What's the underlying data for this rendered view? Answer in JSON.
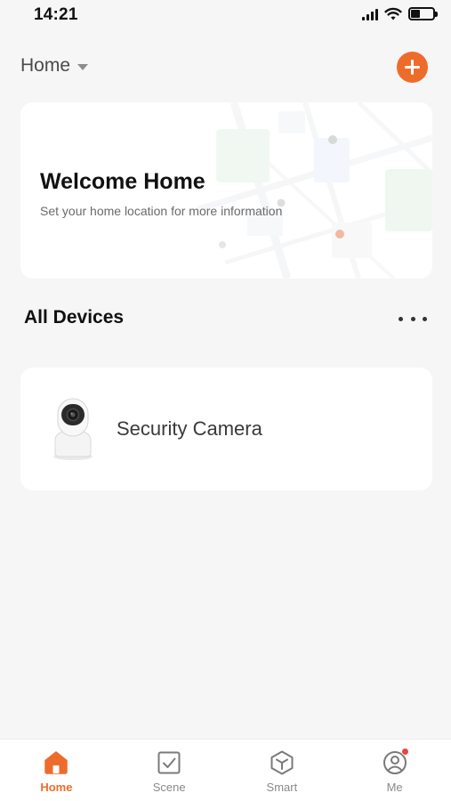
{
  "status_bar": {
    "time": "14:21",
    "icons": [
      "cellular-signal-icon",
      "wifi-icon",
      "battery-icon"
    ]
  },
  "header": {
    "home_label": "Home",
    "dropdown_icon": "caret-down-icon",
    "add_icon": "plus-icon"
  },
  "welcome_card": {
    "title": "Welcome Home",
    "subtitle": "Set your home location for more information"
  },
  "devices_section": {
    "title": "All Devices",
    "more_icon": "more-dots-icon"
  },
  "devices": [
    {
      "name": "Security Camera",
      "icon": "security-camera-icon"
    }
  ],
  "tab_bar": {
    "tabs": [
      {
        "label": "Home",
        "icon": "home-icon",
        "active": true
      },
      {
        "label": "Scene",
        "icon": "scene-checkbox-icon",
        "active": false
      },
      {
        "label": "Smart",
        "icon": "smart-cube-icon",
        "active": false
      },
      {
        "label": "Me",
        "icon": "profile-icon",
        "active": false,
        "badge": true
      }
    ]
  },
  "colors": {
    "accent": "#ee6c2b",
    "background": "#f6f6f6",
    "card": "#ffffff",
    "badge": "#e8453c"
  }
}
